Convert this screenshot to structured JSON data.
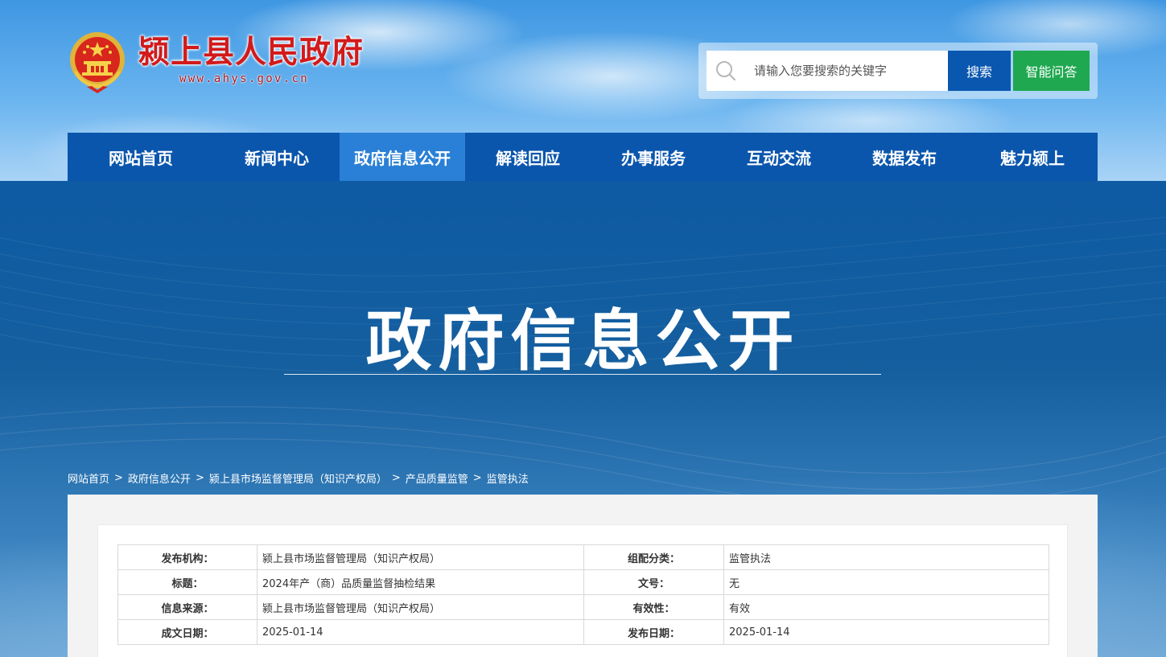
{
  "site": {
    "title": "颍上县人民政府",
    "url": "www.ahys.gov.cn"
  },
  "search": {
    "placeholder": "请输入您要搜索的关键字",
    "search_label": "搜索",
    "ai_label": "智能问答"
  },
  "nav": {
    "items": [
      {
        "label": "网站首页"
      },
      {
        "label": "新闻中心"
      },
      {
        "label": "政府信息公开",
        "active": true
      },
      {
        "label": "解读回应"
      },
      {
        "label": "办事服务"
      },
      {
        "label": "互动交流"
      },
      {
        "label": "数据发布"
      },
      {
        "label": "魅力颍上"
      }
    ]
  },
  "banner": {
    "title": "政府信息公开"
  },
  "breadcrumb": {
    "items": [
      "网站首页",
      "政府信息公开",
      "颍上县市场监督管理局（知识产权局）",
      "产品质量监管",
      "监管执法"
    ],
    "separator": ">"
  },
  "meta": {
    "rows": [
      {
        "k1": "发布机构：",
        "v1": "颍上县市场监督管理局（知识产权局）",
        "k2": "组配分类：",
        "v2": "监管执法"
      },
      {
        "k1": "标题：",
        "v1": "2024年产（商）品质量监督抽检结果",
        "k2": "文号：",
        "v2": "无"
      },
      {
        "k1": "信息来源：",
        "v1": "颍上县市场监督管理局（知识产权局）",
        "k2": "有效性：",
        "v2": "有效"
      },
      {
        "k1": "成文日期：",
        "v1": "2025-01-14",
        "k2": "发布日期：",
        "v2": "2025-01-14"
      }
    ]
  },
  "colors": {
    "nav_bg": "#0b56ad",
    "nav_active": "#2a80d6",
    "search_btn": "#0a57b0",
    "ai_btn": "#1fa850",
    "title_red": "#d21a1a"
  },
  "icons": {
    "emblem": "national-emblem-icon",
    "search": "search-icon"
  }
}
